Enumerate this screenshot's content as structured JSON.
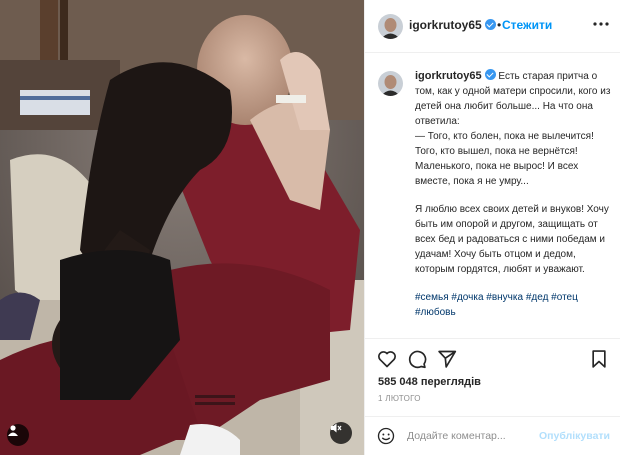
{
  "post": {
    "username": "igorkrutoy65",
    "follow_label": "Стежити",
    "header_separator": "•",
    "caption_paragraphs": [
      "Есть старая притча о том, как у одной матери спросили, кого из детей она любит больше... На что она ответила:\n— Того, кто болен, пока не вылечится! Того, кто вышел, пока не вернётся! Маленького, пока не вырос! И всех вместе, пока я не умру...",
      "Я люблю всех своих детей и внуков! Хочу быть им опорой и другом, защищать от всех бед и радоваться с ними победам и удачам! Хочу быть отцом и дедом, которым гордятся, любят и уважают."
    ],
    "hashtags": "#семья #дочка #внучка #дед #отец #любовь",
    "views": "585 048 переглядів",
    "date": "1 ЛЮТОГО",
    "comment_placeholder": "Додайте коментар...",
    "publish_label": "Опублікувати"
  },
  "icons": {
    "more": "more-horizontal-icon",
    "like": "heart-icon",
    "comment": "comment-icon",
    "share": "share-icon",
    "save": "bookmark-icon",
    "emoji": "emoji-icon",
    "tagged_user": "user-icon",
    "mute": "muted-speaker-icon"
  },
  "colors": {
    "link": "#0095f6",
    "hashtag": "#00376b",
    "verified": "#3897f0",
    "muted": "#8e8e8e"
  }
}
